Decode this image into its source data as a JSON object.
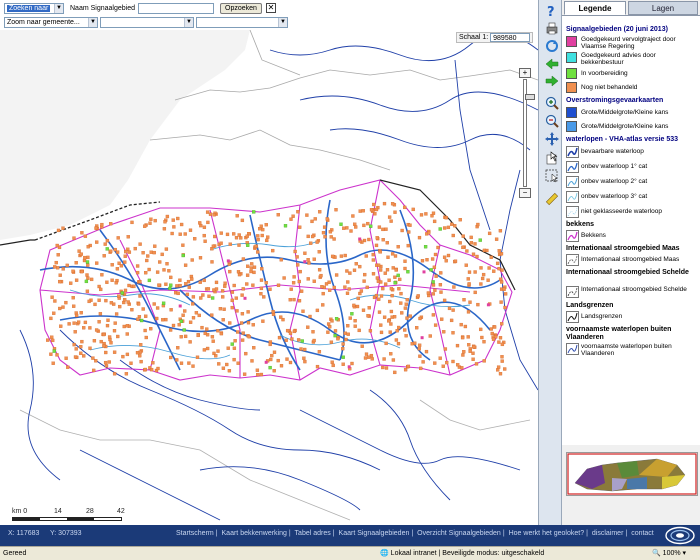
{
  "search": {
    "zoek_select": "Zoeken naar",
    "naam_label": "Naam Signaalgebied",
    "naam_value": "",
    "opzoeken_button": "Opzoeken",
    "zoom_select": "Zoom naar gemeente...",
    "zoom_select2": "",
    "zoom_select3": ""
  },
  "map": {
    "scale_label": "Schaal 1:",
    "scale_value": "989580",
    "scalebar_labels": [
      "km 0",
      "14",
      "28",
      "42"
    ]
  },
  "legend": {
    "tab_legende": "Legende",
    "tab_lagen": "Lagen",
    "groups": [
      {
        "title": "Signaalgebieden (20 juni 2013)",
        "items": [
          {
            "label": "Goedgekeurd vervolgtraject door Vlaamse Regering",
            "color": "#e040a0"
          },
          {
            "label": "Goedgekeurd advies door bekkenbestuur",
            "color": "#40e0e0"
          },
          {
            "label": "In voorbereiding",
            "color": "#70e040"
          },
          {
            "label": "Nog niet behandeld",
            "color": "#f09050"
          }
        ]
      },
      {
        "title": "Overstromingsgevaarkaarten",
        "items": [
          {
            "label": "Grote/Middelgrote/Kleine kans",
            "color": "#1f4fd0"
          },
          {
            "label": "Grote/Middelgrote/Kleine kans",
            "color": "#4a9ae8"
          }
        ]
      },
      {
        "title": "waterlopen - VHA-atlas versie 533",
        "items": [
          {
            "label": "bevaarbare waterloop"
          },
          {
            "label": "onbev waterloop 1° cat"
          },
          {
            "label": "onbev waterloop 2° cat"
          },
          {
            "label": "onbev waterloop 3° cat"
          },
          {
            "label": "niet geklasseerde waterloop"
          }
        ]
      },
      {
        "title": "bekkens",
        "items": [
          {
            "label": "Bekkens"
          }
        ]
      },
      {
        "title": "Internationaal stroomgebied Maas",
        "items": [
          {
            "label": "Internationaal stroomgebied Maas"
          }
        ]
      },
      {
        "title": "Internationaal stroomgebied Schelde",
        "items": [
          {
            "label": "Internationaal stroomgebied Schelde"
          }
        ]
      },
      {
        "title": "Landsgrenzen",
        "items": [
          {
            "label": "Landsgrenzen"
          }
        ]
      },
      {
        "title": "voornaamste waterlopen buiten Vlaanderen",
        "items": [
          {
            "label": "voornaamste waterlopen buiten Vlaanderen"
          }
        ]
      }
    ]
  },
  "status": {
    "x_label": "X: 117683",
    "y_label": "Y: 307393",
    "links": [
      "Startscherm",
      "Kaart bekkenwerking",
      "Tabel adres",
      "Kaart Signaalgebieden",
      "Overzicht Signaalgebieden",
      "Hoe werkt het geoloket?",
      "disclaimer",
      "contact"
    ]
  },
  "browser": {
    "status_left": "Gereed",
    "zone": "Lokaal intranet | Beveiligde modus: uitgeschakeld",
    "zoom": "100%"
  },
  "colors": {
    "status_bar": "#1b3a78",
    "orange_points": "#f09050",
    "green_points": "#70e040",
    "blue_rivers": "#2a66c8",
    "basin_magenta": "#cc33cc"
  }
}
